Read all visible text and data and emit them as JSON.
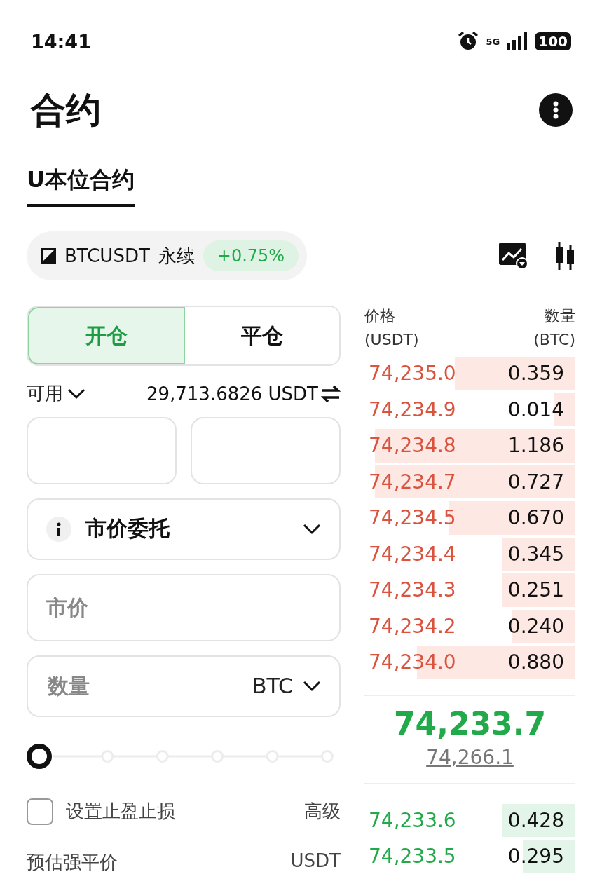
{
  "status_bar": {
    "time": "14:41",
    "network": "5G",
    "battery": "100"
  },
  "header": {
    "title": "合约"
  },
  "tabs": [
    {
      "label": "U本位合约",
      "selected": true
    }
  ],
  "pair": {
    "symbol": "BTCUSDT",
    "type": "永续",
    "change": "+0.75%"
  },
  "side_tabs": [
    {
      "label": "开仓",
      "selected": true
    },
    {
      "label": "平仓",
      "selected": false
    }
  ],
  "available": {
    "label": "可用",
    "value": "29,713.6826 USDT"
  },
  "selectors": [
    {
      "kind": "select"
    },
    {
      "kind": "select"
    }
  ],
  "order_type": {
    "label": "市价委托"
  },
  "price_field": {
    "placeholder": "市价"
  },
  "amount_field": {
    "placeholder": "数量",
    "unit": "BTC"
  },
  "slider": {
    "level": 0
  },
  "tpsl": {
    "label": "设置止盈止损",
    "checked": false,
    "advanced": "高级"
  },
  "liquidation": {
    "label": "预估强平价",
    "unit": "USDT"
  },
  "order_book": {
    "price_header": "价格",
    "price_unit": "(USDT)",
    "amount_header": "数量",
    "amount_unit": "(BTC)",
    "asks": [
      {
        "price": "74,235.0",
        "amount": "0.359"
      },
      {
        "price": "74,234.9",
        "amount": "0.014"
      },
      {
        "price": "74,234.8",
        "amount": "1.186"
      },
      {
        "price": "74,234.7",
        "amount": "0.727"
      },
      {
        "price": "74,234.5",
        "amount": "0.670"
      },
      {
        "price": "74,234.4",
        "amount": "0.345"
      },
      {
        "price": "74,234.3",
        "amount": "0.251"
      },
      {
        "price": "74,234.2",
        "amount": "0.240"
      },
      {
        "price": "74,234.0",
        "amount": "0.880"
      }
    ],
    "last_price": "74,233.7",
    "mark_price": "74,266.1",
    "bids": [
      {
        "price": "74,233.6",
        "amount": "0.428"
      },
      {
        "price": "74,233.5",
        "amount": "0.295"
      }
    ]
  }
}
